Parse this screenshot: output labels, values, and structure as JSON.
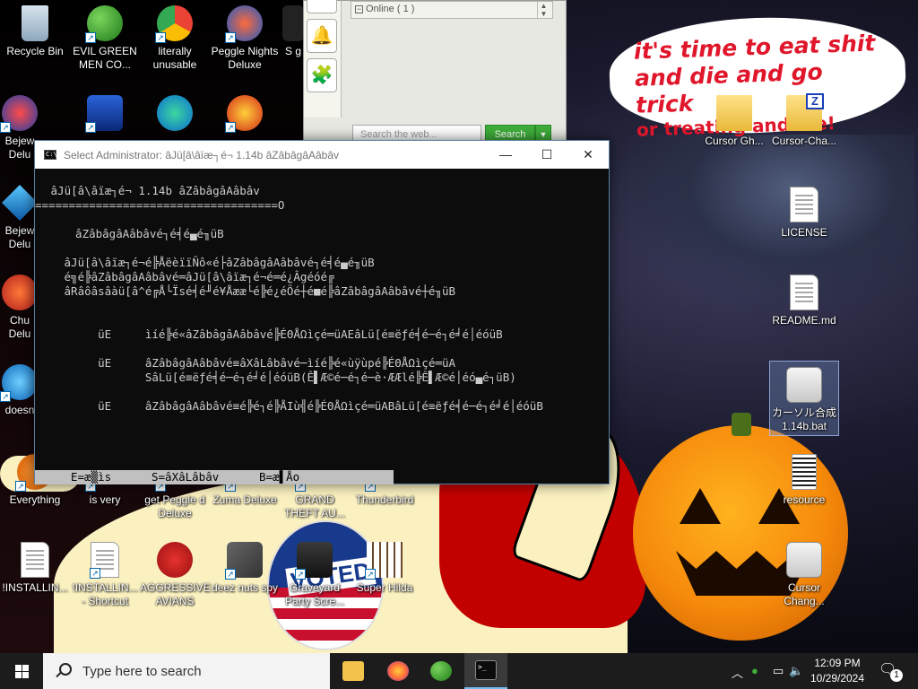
{
  "desktop": {
    "icons": [
      {
        "label": "Recycle Bin"
      },
      {
        "label": "EVIL GREEN MEN CO..."
      },
      {
        "label": "literally unusable"
      },
      {
        "label": "Peggle Nights Deluxe"
      },
      {
        "label": "S g"
      },
      {
        "label": "Bejew Delu"
      },
      {
        "label": "Bejew Delu"
      },
      {
        "label": "Chu Delu"
      },
      {
        "label": "doesn"
      },
      {
        "label": "Everything"
      },
      {
        "label": "is very"
      },
      {
        "label": "get Peggle d Deluxe"
      },
      {
        "label": "Zuma Deluxe"
      },
      {
        "label": "GRAND THEFT AU..."
      },
      {
        "label": "Thunderbird"
      },
      {
        "label": "!INSTALLIN..."
      },
      {
        "label": "!INSTALLIN... - Shortcut"
      },
      {
        "label": "AGGRESSIVE AVIANS"
      },
      {
        "label": "deez nuts spy"
      },
      {
        "label": "Graveyard Party Scre..."
      },
      {
        "label": "Super Hilda"
      },
      {
        "label": "Cursor Gh..."
      },
      {
        "label": "Cursor-Cha..."
      },
      {
        "label": "LICENSE"
      },
      {
        "label": "README.md"
      },
      {
        "label": "カーソル合成 1.14b.bat"
      },
      {
        "label": "resource"
      },
      {
        "label": "Cursor Chang..."
      }
    ],
    "wallpaper_text": {
      "line1": "it's time to eat shit",
      "line2": "and die and go trick",
      "line3": "or treating and die!"
    },
    "badge_text": "VOTED"
  },
  "messenger": {
    "online_label": "Online ( 1 )",
    "search_placeholder": "Search the web...",
    "search_button": "Search",
    "accent": "#3fae3a"
  },
  "console": {
    "title": "Select Administrator:  âJü[â\\âïæ┐é¬ 1.14b âZâbâgâAâbâv",
    "minimize": "—",
    "maximize": "☐",
    "close": "✕",
    "lines": [
      " âJü[â\\âïæ┐é¬ 1.14b âZâbâgâAâbâv",
      "====================================O",
      "",
      "  âZâbâgâAâbâvé┐é╡é▄é╖üB",
      "",
      " âJü[â\\âïæ┐é¬é╠ÅëèïïÑô«é├âZâbâgâAâbâvé┐é╡é▄é╖üB",
      " é╗é╠âZâbâgâAâbâvé═âJü[â\\âïæ┐é¬é═é¿Âgéóé╔",
      " âRâôâsâàü[â^é╔Å└Ïsé╡é╜é¥Åææ└é╠é¿éÖé┼é■é╠âZâbâgâAâbâvé┼é╖üB",
      "",
      "",
      "      üE     ìíé╠é«âZâbâgâAâbâvé╠ÉΘÅΩìçé═üAEâLü[é≡ëƒé╡é─é┐é╛é│éóüB",
      "",
      "      üE     âZâbâgâAâbâvé≡âXâLâbâvé─ìíé╠é«ùÿùpé╠ÉΘÅΩìçé═üA",
      "             SâLü[é≡ëƒé╡é─é┐é╛é│éóüB(Ê▌Æ©é─é┐é─è·ÆÆlé╠Ê▌Æ©é│éó▄é┐üB)",
      "",
      "      üE     âZâbâgâAâbâvé≡é╠é┐é╠ÅIù╣é╠ÉΘÅΩìçé═üABâLü[é≡ëƒé╡é─é┐é╛é│éóüB"
    ],
    "status": {
      "e": "E=æ▒ìs",
      "s": "S=âXâLâbâv",
      "b": "B=æ▌Åo"
    }
  },
  "taskbar": {
    "search_placeholder": "Type here to search",
    "apps": [
      {
        "name": "File Explorer",
        "color": "#f3c34b"
      },
      {
        "name": "Firefox",
        "color": "#ff7139"
      },
      {
        "name": "Messenger",
        "color": "#3fae3a"
      },
      {
        "name": "Command Prompt",
        "color": "#0c0c0c"
      }
    ],
    "time": "12:09 PM",
    "date": "10/29/2024",
    "notification_count": "1"
  }
}
